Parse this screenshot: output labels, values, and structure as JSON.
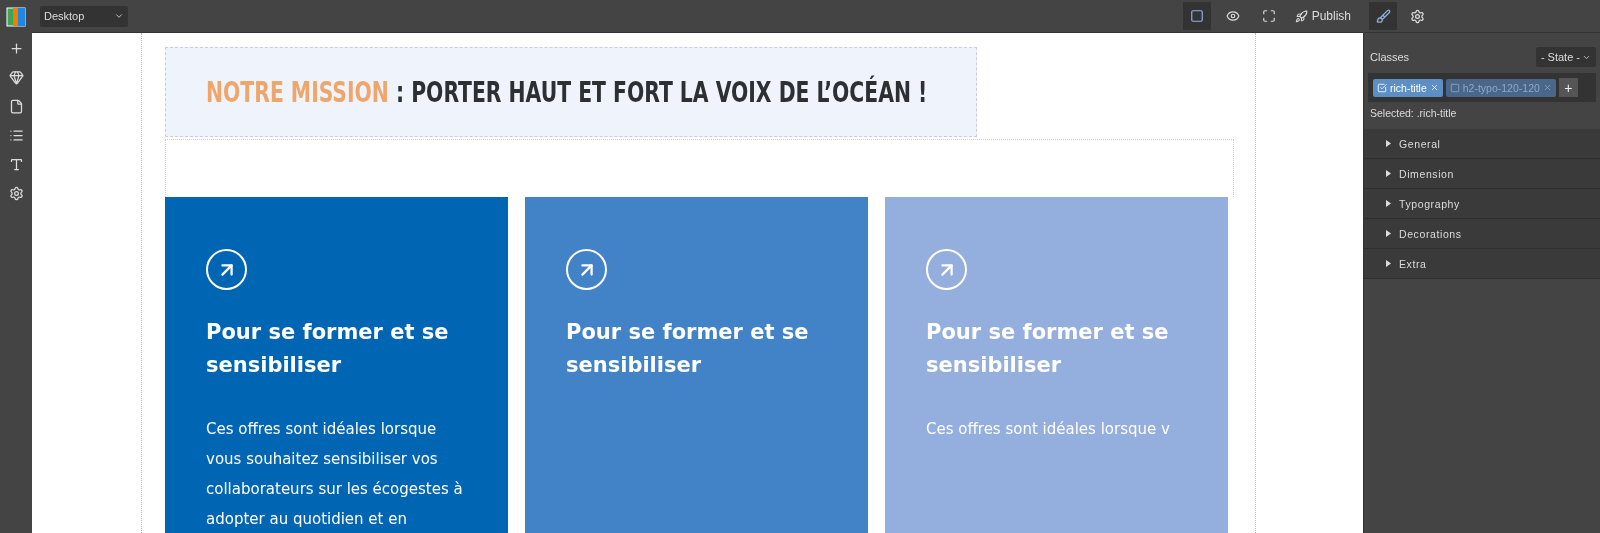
{
  "topbar": {
    "device": "Desktop",
    "publish": "Publish",
    "tools": [
      {
        "kind": "outline",
        "selected": true
      },
      {
        "kind": "preview",
        "selected": false
      },
      {
        "kind": "fullscreen",
        "selected": false
      }
    ],
    "panel_tabs": [
      {
        "kind": "style",
        "selected": true
      },
      {
        "kind": "settings",
        "selected": false
      }
    ]
  },
  "sidebar": {
    "items": [
      {
        "kind": "add"
      },
      {
        "kind": "diamond"
      },
      {
        "kind": "page"
      },
      {
        "kind": "list"
      },
      {
        "kind": "font"
      },
      {
        "kind": "settings"
      }
    ]
  },
  "page": {
    "title": {
      "highlight": "NOTRE MISSION",
      "rest": " : PORTER HAUT ET FORT LA VOIX DE L’OCÉAN !"
    },
    "cards": [
      {
        "color": "#0066b3",
        "heading": "Pour se former et se sensibiliser",
        "text": "Ces offres sont idéales lorsque vous souhaitez sensibiliser vos collaborateurs sur les écogestes à adopter au quotidien et en"
      },
      {
        "color": "#4282c6",
        "heading": "Pour se former et se sensibiliser"
      },
      {
        "color": "#94aedd",
        "heading": "Pour se former et se sensibiliser",
        "text": "Ces offres sont idéales lorsque v"
      }
    ]
  },
  "style_panel": {
    "classes_label": "Classes",
    "state": "- State -",
    "tags": [
      {
        "label": "rich-title",
        "checked": true
      },
      {
        "label": "h2-typo-120-120",
        "checked": false
      }
    ],
    "add": "+",
    "selected_label": "Selected:",
    "selected_value": ".rich-title",
    "sections": [
      {
        "label": "General",
        "expanded": false
      },
      {
        "label": "Dimension",
        "expanded": false
      },
      {
        "label": "Typography",
        "expanded": false
      },
      {
        "label": "Decorations",
        "expanded": false
      },
      {
        "label": "Extra",
        "expanded": false
      }
    ]
  }
}
